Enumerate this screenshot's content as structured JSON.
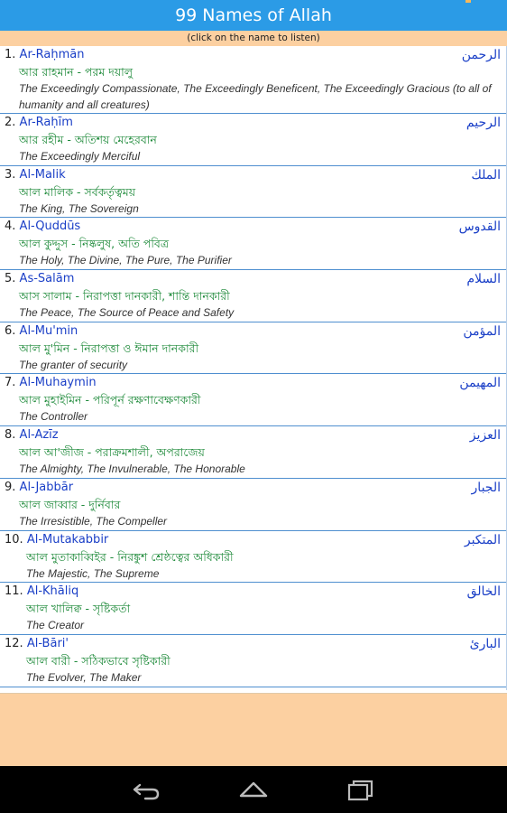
{
  "app": {
    "title": "99 Names of Allah",
    "subtitle": "(click on the name to listen)"
  },
  "names": [
    {
      "num": "1.",
      "translit": "Ar-Raḥmān",
      "arabic": "الرحمن",
      "bangla": "আর রাহমান - পরম দয়ালু",
      "english": "The Exceedingly Compassionate, The Exceedingly Beneficent, The Exceedingly Gracious (to all of humanity and all creatures)"
    },
    {
      "num": "2.",
      "translit": "Ar-Raḥīm",
      "arabic": "الرحيم",
      "bangla": "আর রহীম - অতিশয় মেহেরবান",
      "english": "The Exceedingly Merciful"
    },
    {
      "num": "3.",
      "translit": "Al-Malik",
      "arabic": "الملك",
      "bangla": "আল মালিক - সর্বকর্তৃত্বময়",
      "english": "The King, The Sovereign"
    },
    {
      "num": "4.",
      "translit": "Al-Quddūs",
      "arabic": "القدوس",
      "bangla": "আল কুদ্দুস - নিষ্কলুষ, অতি পবিত্র",
      "english": "The Holy, The Divine, The Pure, The Purifier"
    },
    {
      "num": "5.",
      "translit": "As-Salām",
      "arabic": "السلام",
      "bangla": "আস সালাম - নিরাপত্তা দানকারী, শান্তি দানকারী",
      "english": "The Peace, The Source of Peace and Safety"
    },
    {
      "num": "6.",
      "translit": "Al-Mu'min",
      "arabic": "المؤمن",
      "bangla": "আল মু'মিন - নিরাপত্তা ও ঈমান দানকারী",
      "english": "The granter of security"
    },
    {
      "num": "7.",
      "translit": "Al-Muhaymin",
      "arabic": "المهيمن",
      "bangla": "আল মুহাইমিন - পরিপূর্ন রক্ষণাবেক্ষণকারী",
      "english": "The Controller"
    },
    {
      "num": "8.",
      "translit": "Al-Azīz",
      "arabic": "العزيز",
      "bangla": "আল আ'জীজ - পরাক্রমশালী, অপরাজেয়",
      "english": "The Almighty, The Invulnerable, The Honorable"
    },
    {
      "num": "9.",
      "translit": "Al-Jabbār",
      "arabic": "الجبار",
      "bangla": "আল জাব্বার - দুর্নিবার",
      "english": "The Irresistible, The Compeller"
    },
    {
      "num": "10.",
      "translit": "Al-Mutakabbir",
      "arabic": "المتكبر",
      "bangla": "আল মুতাকাব্বিইর - নিরঙ্কুশ শ্রেষ্ঠত্বের অধিকারী",
      "english": "The Majestic, The Supreme"
    },
    {
      "num": "11.",
      "translit": "Al-Khāliq",
      "arabic": "الخالق",
      "bangla": "আল খালিক্ব - সৃষ্টিকর্তা",
      "english": "The Creator"
    },
    {
      "num": "12.",
      "translit": "Al-Bāri'",
      "arabic": "البارئ",
      "bangla": "আল বারী - সঠিকভাবে সৃষ্টিকারী",
      "english": "The Evolver, The Maker"
    }
  ],
  "navbar": {
    "back_icon": "back-arrow-icon",
    "home_icon": "home-icon",
    "recents_icon": "recent-apps-icon"
  },
  "colors": {
    "titlebar": "#2b9be6",
    "subtitle_bg": "#fcd0a1",
    "translit": "#1a3fc7",
    "bangla": "#1e8a3a",
    "divider": "#4f8fd0"
  }
}
